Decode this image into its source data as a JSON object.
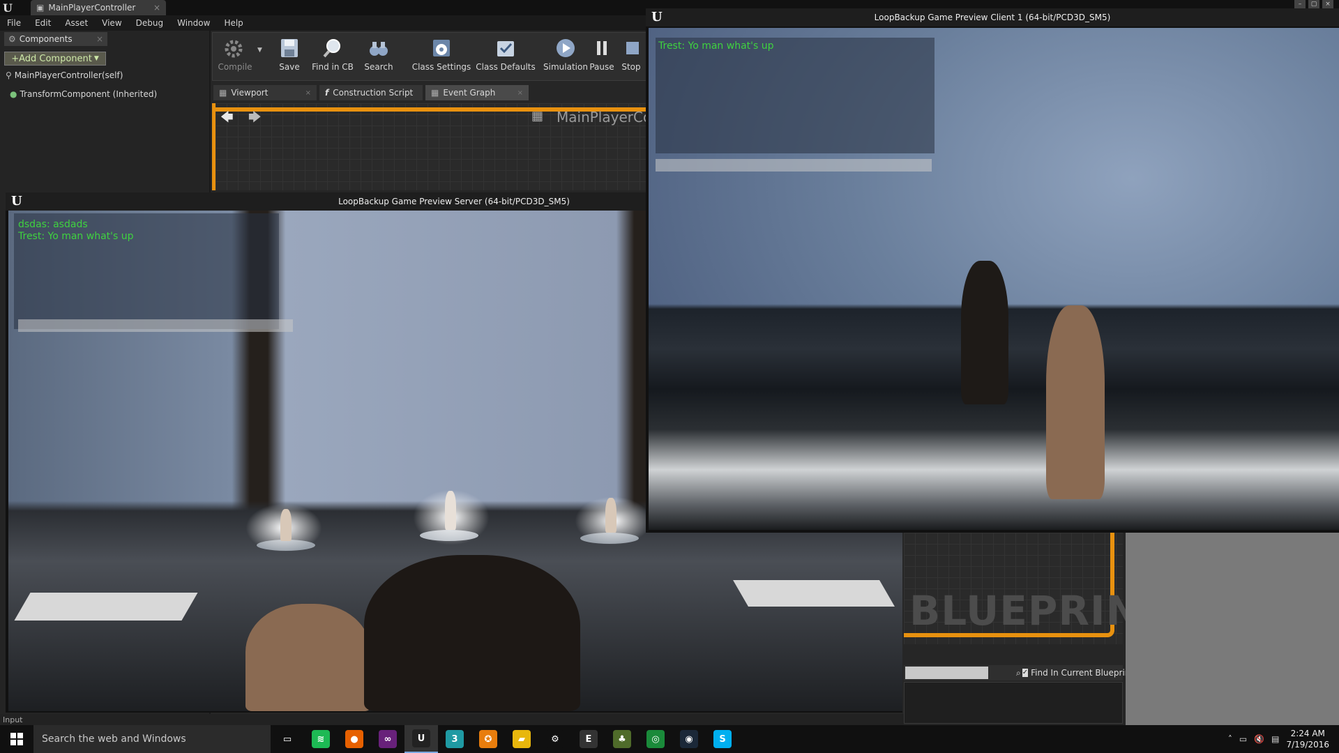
{
  "editor": {
    "tab_title": "MainPlayerController",
    "menu": [
      "File",
      "Edit",
      "Asset",
      "View",
      "Debug",
      "Window",
      "Help"
    ],
    "components_tab": "Components",
    "add_component": "+Add Component",
    "tree": [
      "MainPlayerController(self)",
      "TransformComponent (Inherited)"
    ],
    "toolbar": [
      "Compile",
      "Save",
      "Find in CB",
      "Search",
      "Class Settings",
      "Class Defaults",
      "Simulation",
      "Pause",
      "Stop"
    ],
    "graph_tabs": [
      "Viewport",
      "Construction Script",
      "Event Graph"
    ],
    "graph_title": "MainPlayerCon",
    "blueprint_watermark": "BLUEPRINT",
    "find_label": "Find In Current Blueprint Only",
    "input_label": "Input"
  },
  "client_window": {
    "title": "LoopBackup Game Preview Client 1 (64-bit/PCD3D_SM5)",
    "chat": [
      "Trest: Yo man what's up"
    ]
  },
  "server_window": {
    "title": "LoopBackup Game Preview Server (64-bit/PCD3D_SM5)",
    "chat": [
      "dsdas: asdads",
      "Trest: Yo man what's up"
    ]
  },
  "taskbar": {
    "search_placeholder": "Search the web and Windows",
    "apps": [
      {
        "name": "task-view",
        "glyph": "▭",
        "color": "#101010"
      },
      {
        "name": "spotify",
        "glyph": "≋",
        "color": "#1db954"
      },
      {
        "name": "firefox",
        "glyph": "●",
        "color": "#e66000"
      },
      {
        "name": "visual-studio",
        "glyph": "∞",
        "color": "#68217a"
      },
      {
        "name": "unreal",
        "glyph": "U",
        "color": "#222222"
      },
      {
        "name": "3ds-max",
        "glyph": "3",
        "color": "#1f9aa3"
      },
      {
        "name": "blender",
        "glyph": "✪",
        "color": "#e87d0d"
      },
      {
        "name": "file-explorer",
        "glyph": "▰",
        "color": "#e8b70d"
      },
      {
        "name": "settings",
        "glyph": "⚙",
        "color": "#101010"
      },
      {
        "name": "epic",
        "glyph": "E",
        "color": "#333333"
      },
      {
        "name": "game",
        "glyph": "♣",
        "color": "#4f6b2a"
      },
      {
        "name": "origin",
        "glyph": "◎",
        "color": "#1a8a3a"
      },
      {
        "name": "steam",
        "glyph": "◉",
        "color": "#1b2838"
      },
      {
        "name": "skype",
        "glyph": "S",
        "color": "#00aff0"
      }
    ],
    "time": "2:24 AM",
    "date": "7/19/2016"
  }
}
